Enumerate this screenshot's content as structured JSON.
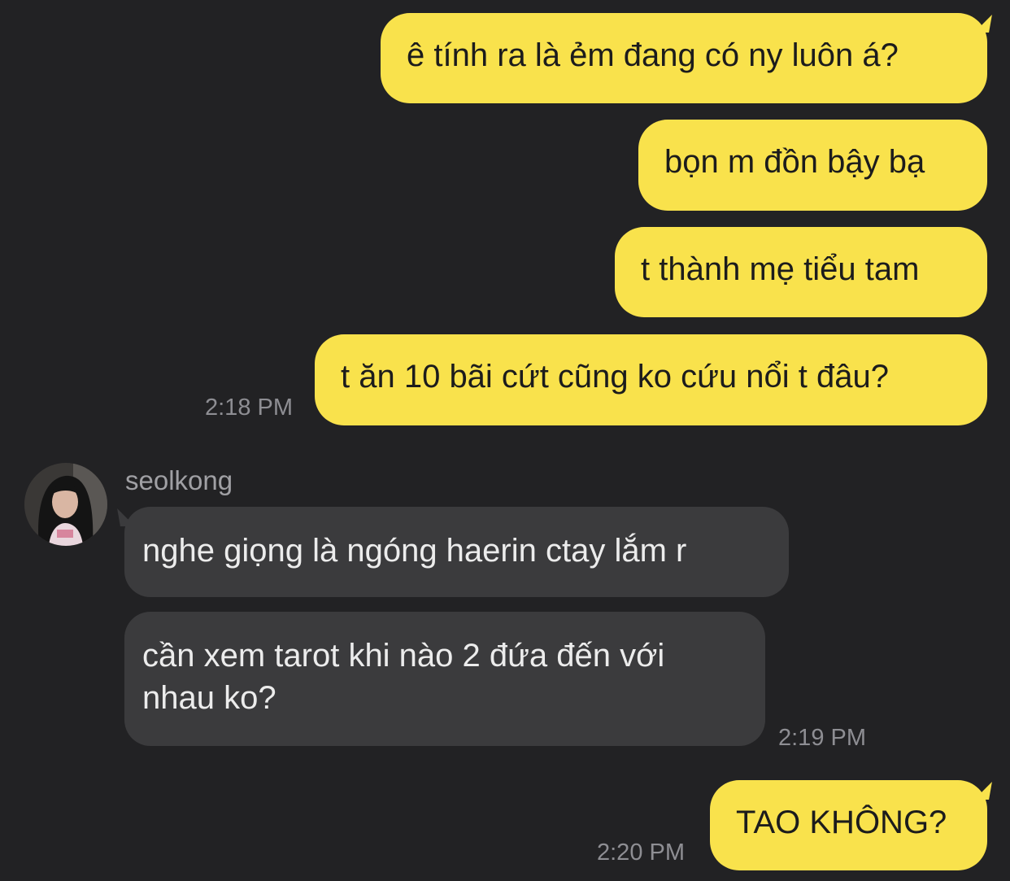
{
  "messages": [
    {
      "text": "ê tính ra là ẻm đang có ny luôn á?"
    },
    {
      "text": "bọn m đồn bậy bạ"
    },
    {
      "text": "t thành mẹ tiểu tam"
    },
    {
      "text": "t ăn 10 bãi cứt cũng ko cứu nổi t đâu?"
    },
    {
      "text": "nghe giọng là ngóng haerin ctay lắm r"
    },
    {
      "text": "cần xem tarot khi nào 2 đứa đến với nhau ko?"
    },
    {
      "text": "TAO KHÔNG?"
    }
  ],
  "timestamps": {
    "t1": "2:18 PM",
    "t2": "2:19 PM",
    "t3": "2:20 PM"
  },
  "sender": {
    "name": "seolkong"
  },
  "colors": {
    "outgoing_bubble": "#f9e24c",
    "incoming_bubble": "#3b3b3d",
    "background": "#222224"
  }
}
